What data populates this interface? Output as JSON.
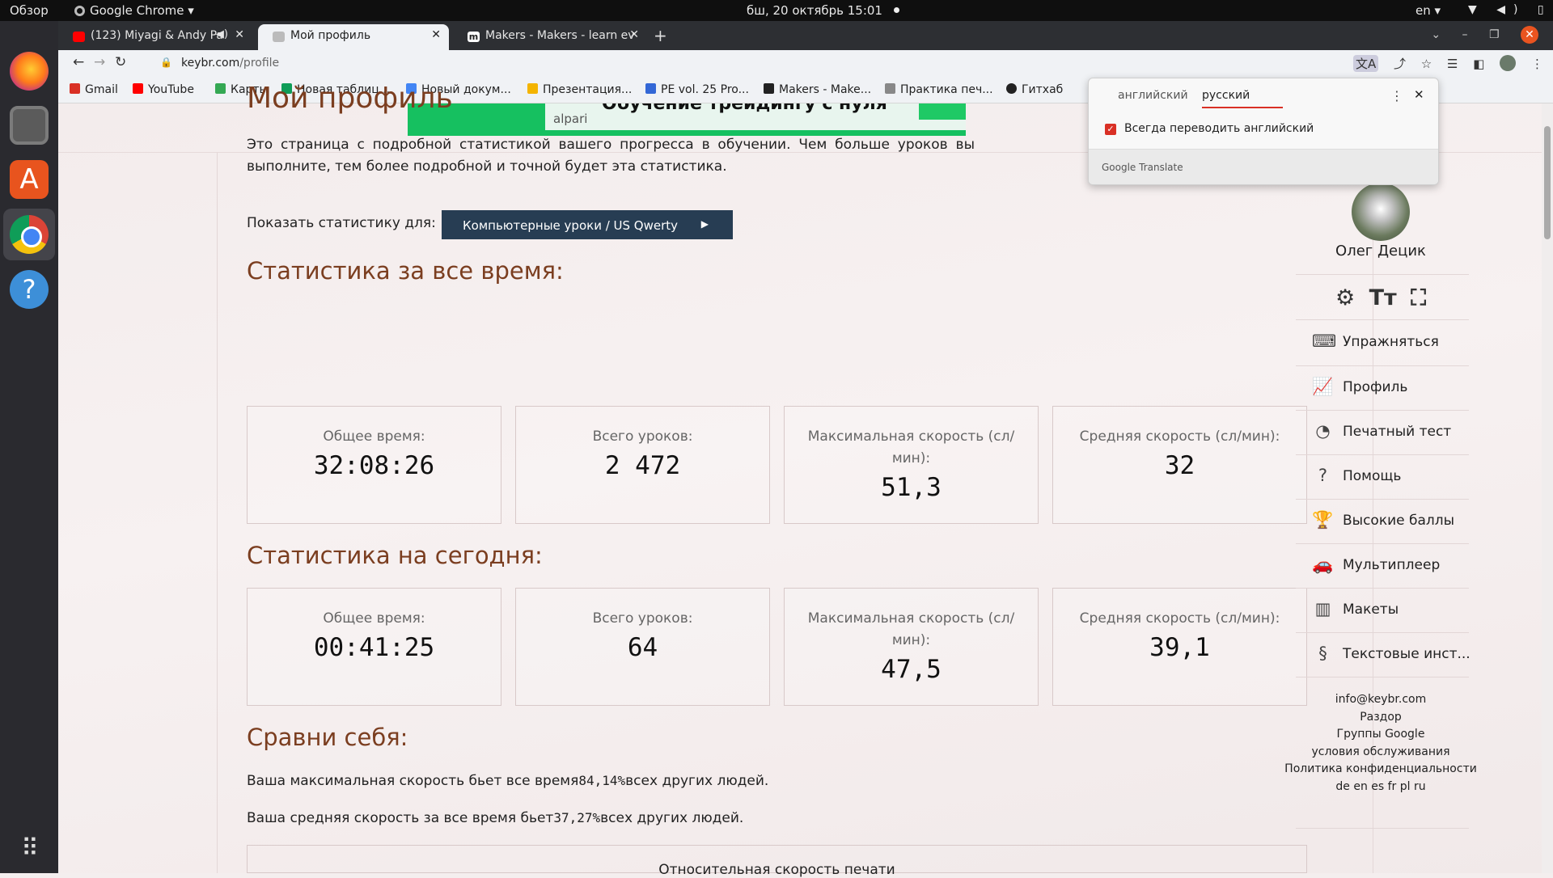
{
  "topbar": {
    "overview": "Обзор",
    "app_name": "Google Chrome ▾",
    "datetime": "бш, 20 октябрь  15:01",
    "lang": "en ▾",
    "sys_icons": "▼ ◀) ▯ ▾"
  },
  "tabs": [
    {
      "title": "(123) Miyagi & Andy Pa"
    },
    {
      "title": "Мой профиль"
    },
    {
      "title": "Makers - Makers - learn ev"
    }
  ],
  "address": {
    "host": "keybr.com",
    "path": "/profile"
  },
  "bookmarks": [
    "Gmail",
    "YouTube",
    "Карты",
    "Новая таблиц...",
    "Новый докум...",
    "Презентация...",
    "PE vol. 25 Pro...",
    "Makers - Make...",
    "Практика печ...",
    "Гитхаб"
  ],
  "ad": {
    "brand": "alpari",
    "headline": "Обучение трейдингу с нуля"
  },
  "page": {
    "title": "Мой профиль",
    "intro": "Это страница с подробной статистикой вашего прогресса в обучении. Чем больше уроков вы выполните, тем более подробной и точной будет эта статистика.",
    "show_label": "Показать статистику для:",
    "select_value": "Компьютерные уроки / US Qwerty",
    "all_time": {
      "title": "Статистика за все время:",
      "cards": [
        {
          "label": "Общее время:",
          "value": "32:08:26"
        },
        {
          "label": "Всего уроков:",
          "value": "2 472"
        },
        {
          "label": "Максимальная скорость (сл/мин):",
          "value": "51,3"
        },
        {
          "label": "Средняя скорость (сл/мин):",
          "value": "32"
        }
      ]
    },
    "today": {
      "title": "Статистика на сегодня:",
      "cards": [
        {
          "label": "Общее время:",
          "value": "00:41:25"
        },
        {
          "label": "Всего уроков:",
          "value": "64"
        },
        {
          "label": "Максимальная скорость (сл/мин):",
          "value": "47,5"
        },
        {
          "label": "Средняя скорость (сл/мин):",
          "value": "39,1"
        }
      ]
    },
    "compare": {
      "title": "Сравни себя:",
      "max_pre": "Ваша максимальная скорость бьет все время",
      "max_pct": "84,14%",
      "max_post": "всех других людей.",
      "avg_pre": "Ваша средняя скорость за все время бьет",
      "avg_pct": "37,27%",
      "avg_post": "всех других людей.",
      "relative_title": "Относительная скорость печати"
    }
  },
  "sidebar": {
    "username": "Олег Децик",
    "tools": [
      "⚙",
      "Tт",
      "⛶"
    ],
    "nav": [
      {
        "label": "Упражняться",
        "icon": "⌨"
      },
      {
        "label": "Профиль",
        "icon": "📈"
      },
      {
        "label": "Печатный тест",
        "icon": "◔"
      },
      {
        "label": "Помощь",
        "icon": "?"
      },
      {
        "label": "Высокие баллы",
        "icon": "🏆"
      },
      {
        "label": "Мультиплеер",
        "icon": "🚗"
      },
      {
        "label": "Макеты",
        "icon": "▥"
      },
      {
        "label": "Текстовые инст...",
        "icon": "§"
      }
    ],
    "links": [
      "info@keybr.com",
      "Раздор",
      "Группы Google",
      "условия обслуживания",
      "Политика конфиденциальности",
      "de en es fr pl ru"
    ]
  },
  "translate_popup": {
    "lang_from": "английский",
    "lang_to": "русский",
    "always_translate": "Всегда переводить английский",
    "footer": "Google Translate"
  },
  "colors": {
    "accent_heading": "#7b3e20",
    "select_bg": "#273d53",
    "translate_red": "#d93025"
  }
}
